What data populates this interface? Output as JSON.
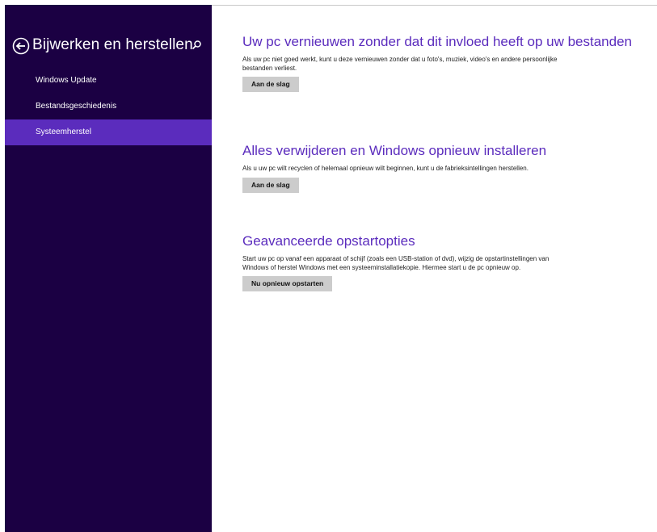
{
  "sidebar": {
    "title": "Bijwerken en herstellen",
    "back_icon": "back-arrow-circle-icon",
    "search_icon": "search-icon",
    "background": "#1b0043",
    "items": [
      {
        "label": "Windows Update",
        "selected": false
      },
      {
        "label": "Bestandsgeschiedenis",
        "selected": false
      },
      {
        "label": "Systeemherstel",
        "selected": true
      }
    ],
    "selected_color": "#5b2cbd"
  },
  "main": {
    "accent": "#5b2cbd",
    "sections": [
      {
        "heading": "Uw pc vernieuwen zonder dat dit invloed heeft op uw bestanden",
        "description": "Als uw pc niet goed werkt, kunt u deze vernieuwen zonder dat u foto's, muziek, video's en andere persoonlijke bestanden verliest.",
        "button": "Aan de slag"
      },
      {
        "heading": "Alles verwijderen en Windows opnieuw installeren",
        "description": "Als u uw pc wilt recyclen of helemaal opnieuw wilt beginnen, kunt u de fabrieksintellingen herstellen.",
        "button": "Aan de slag"
      },
      {
        "heading": "Geavanceerde opstartopties",
        "description": "Start uw pc op vanaf een apparaat of schijf (zoals een USB-station of dvd), wijzig de opstartinstellingen van Windows of herstel Windows met een systeeminstallatiekopie. Hiermee start u de pc opnieuw op.",
        "button": "Nu opnieuw opstarten"
      }
    ]
  }
}
